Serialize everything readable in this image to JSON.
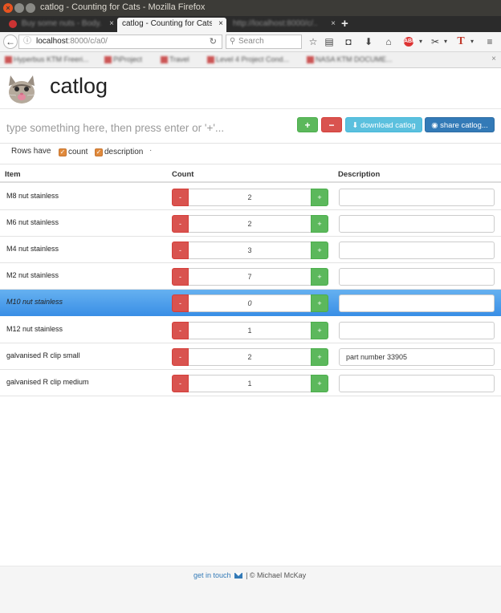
{
  "window": {
    "title": "catlog - Counting for Cats - Mozilla Firefox"
  },
  "tabs": [
    {
      "label": "Buy some nuts - Body..."
    },
    {
      "label": "catlog - Counting for Cats"
    },
    {
      "label": "http://localhost:8000/c/..."
    }
  ],
  "navbar": {
    "url_host": "localhost",
    "url_path": ":8000/c/a0/",
    "search_placeholder": "Search",
    "abp_label": "ABP"
  },
  "bookmarks": [
    {
      "label": "Hyperbus KTM Freeri..."
    },
    {
      "label": "PiProject"
    },
    {
      "label": "Travel"
    },
    {
      "label": "Level 4 Project Cond..."
    },
    {
      "label": "NASA KTM DOCUME..."
    }
  ],
  "app": {
    "title": "catlog",
    "entry_placeholder": "type something here, then press enter or '+'...",
    "add_label": "+",
    "remove_label": "−",
    "download_label": "download catlog",
    "share_label": "share catlog...",
    "rows_have_label": "Rows have",
    "count_option": "count",
    "description_option": "description",
    "dot": "·"
  },
  "table": {
    "headers": {
      "item": "Item",
      "count": "Count",
      "description": "Description"
    },
    "dec_label": "-",
    "inc_label": "+",
    "rows": [
      {
        "item": "M8 nut stainless",
        "count": "2",
        "description": ""
      },
      {
        "item": "M6 nut stainless",
        "count": "2",
        "description": ""
      },
      {
        "item": "M4 nut stainless",
        "count": "3",
        "description": ""
      },
      {
        "item": "M2 nut stainless",
        "count": "7",
        "description": ""
      },
      {
        "item": "M10 nut stainless",
        "count": "0",
        "description": "",
        "selected": true
      },
      {
        "item": "M12 nut stainless",
        "count": "1",
        "description": ""
      },
      {
        "item": "galvanised R clip small",
        "count": "2",
        "description": "part number 33905"
      },
      {
        "item": "galvanised R clip medium",
        "count": "1",
        "description": ""
      }
    ]
  },
  "footer": {
    "link": "get in touch",
    "separator": "|",
    "credit": "© Michael McKay"
  },
  "colors": {
    "accent_green": "#5cb85c",
    "accent_red": "#d9534f",
    "info": "#5bc0de",
    "primary": "#337ab7",
    "selected_row": "#3a8fe6"
  }
}
